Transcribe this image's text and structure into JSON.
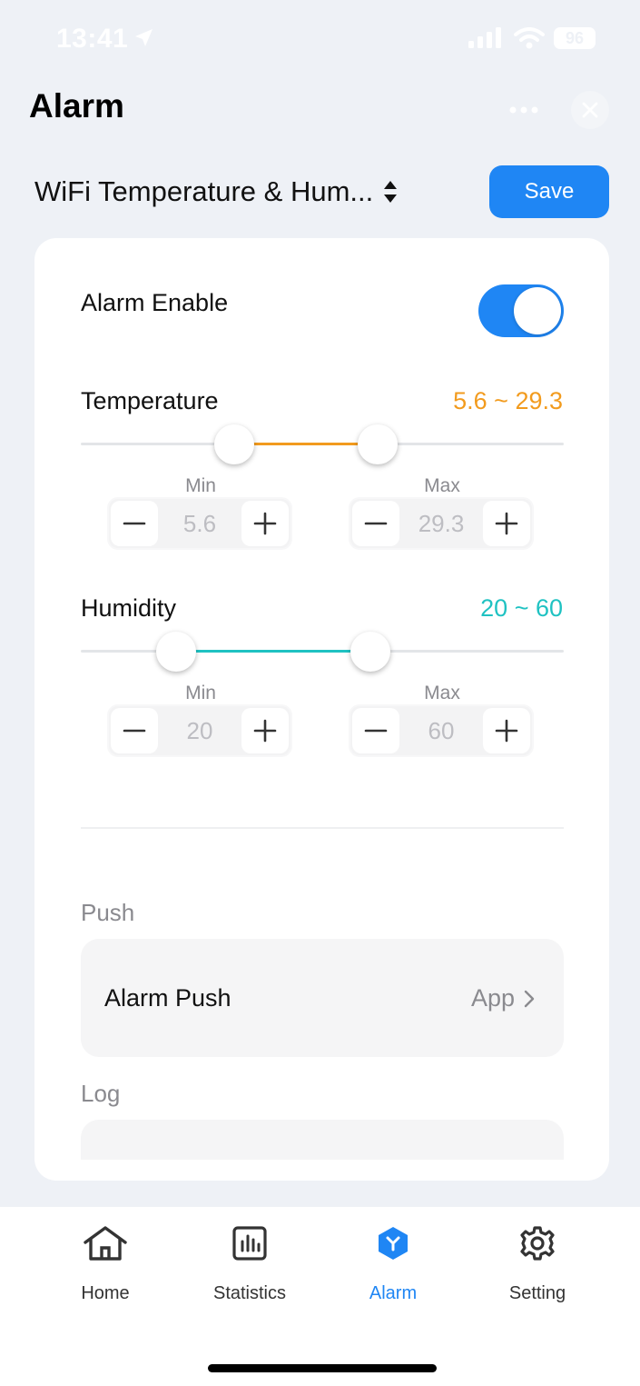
{
  "status_bar": {
    "time": "13:41",
    "battery": "96"
  },
  "header": {
    "title": "Alarm"
  },
  "device": {
    "name": "WiFi Temperature & Hum...",
    "save_label": "Save"
  },
  "alarm_enable": {
    "label": "Alarm Enable",
    "on": true
  },
  "temperature": {
    "label": "Temperature",
    "range_text": "5.6 ~ 29.3",
    "color": "#f29b1e",
    "min_label": "Min",
    "min_value": "5.6",
    "max_label": "Max",
    "max_value": "29.3"
  },
  "humidity": {
    "label": "Humidity",
    "range_text": "20 ~ 60",
    "color": "#1fc2c2",
    "min_label": "Min",
    "min_value": "20",
    "max_label": "Max",
    "max_value": "60"
  },
  "push": {
    "section": "Push",
    "item_label": "Alarm Push",
    "item_value": "App"
  },
  "log": {
    "section": "Log"
  },
  "tabs": [
    {
      "label": "Home",
      "icon": "home-icon"
    },
    {
      "label": "Statistics",
      "icon": "statistics-icon"
    },
    {
      "label": "Alarm",
      "icon": "alarm-icon",
      "active": true
    },
    {
      "label": "Setting",
      "icon": "gear-icon"
    }
  ],
  "colors": {
    "accent": "#1f86f4",
    "background": "#eef1f6"
  }
}
